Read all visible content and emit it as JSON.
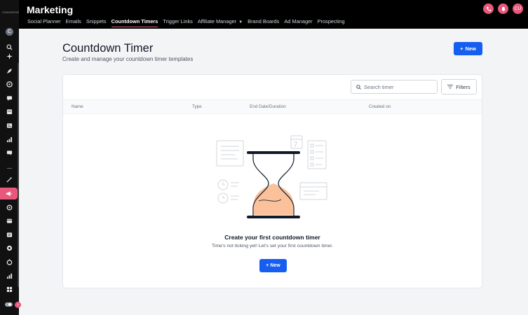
{
  "sidebar": {
    "logo_text": "CONVERGE",
    "avatar_initial": "C"
  },
  "header": {
    "app_title": "Marketing",
    "tabs": [
      {
        "label": "Social Planner"
      },
      {
        "label": "Emails"
      },
      {
        "label": "Snippets"
      },
      {
        "label": "Countdown Timers",
        "active": true
      },
      {
        "label": "Trigger Links"
      },
      {
        "label": "Affiliate Manager"
      },
      {
        "label": "Brand Boards"
      },
      {
        "label": "Ad Manager"
      },
      {
        "label": "Prospecting"
      }
    ],
    "user_initials": "CU"
  },
  "page": {
    "title": "Countdown Timer",
    "subtitle": "Create and manage your countdown timer templates",
    "new_button": "New"
  },
  "table": {
    "search_placeholder": "Search timer",
    "filters_label": "Filters",
    "columns": [
      "Name",
      "Type",
      "End Date/Duration",
      "Created on"
    ]
  },
  "empty_state": {
    "title": "Create your first countdown timer",
    "subtitle": "Time's not ticking yet! Let's set your first countdown timer.",
    "button": "New",
    "calendar_day": "7"
  },
  "colors": {
    "accent_pink": "#e9587a",
    "primary_blue": "#155eef",
    "header_bg": "#000000",
    "sand": "#fbc19b"
  }
}
